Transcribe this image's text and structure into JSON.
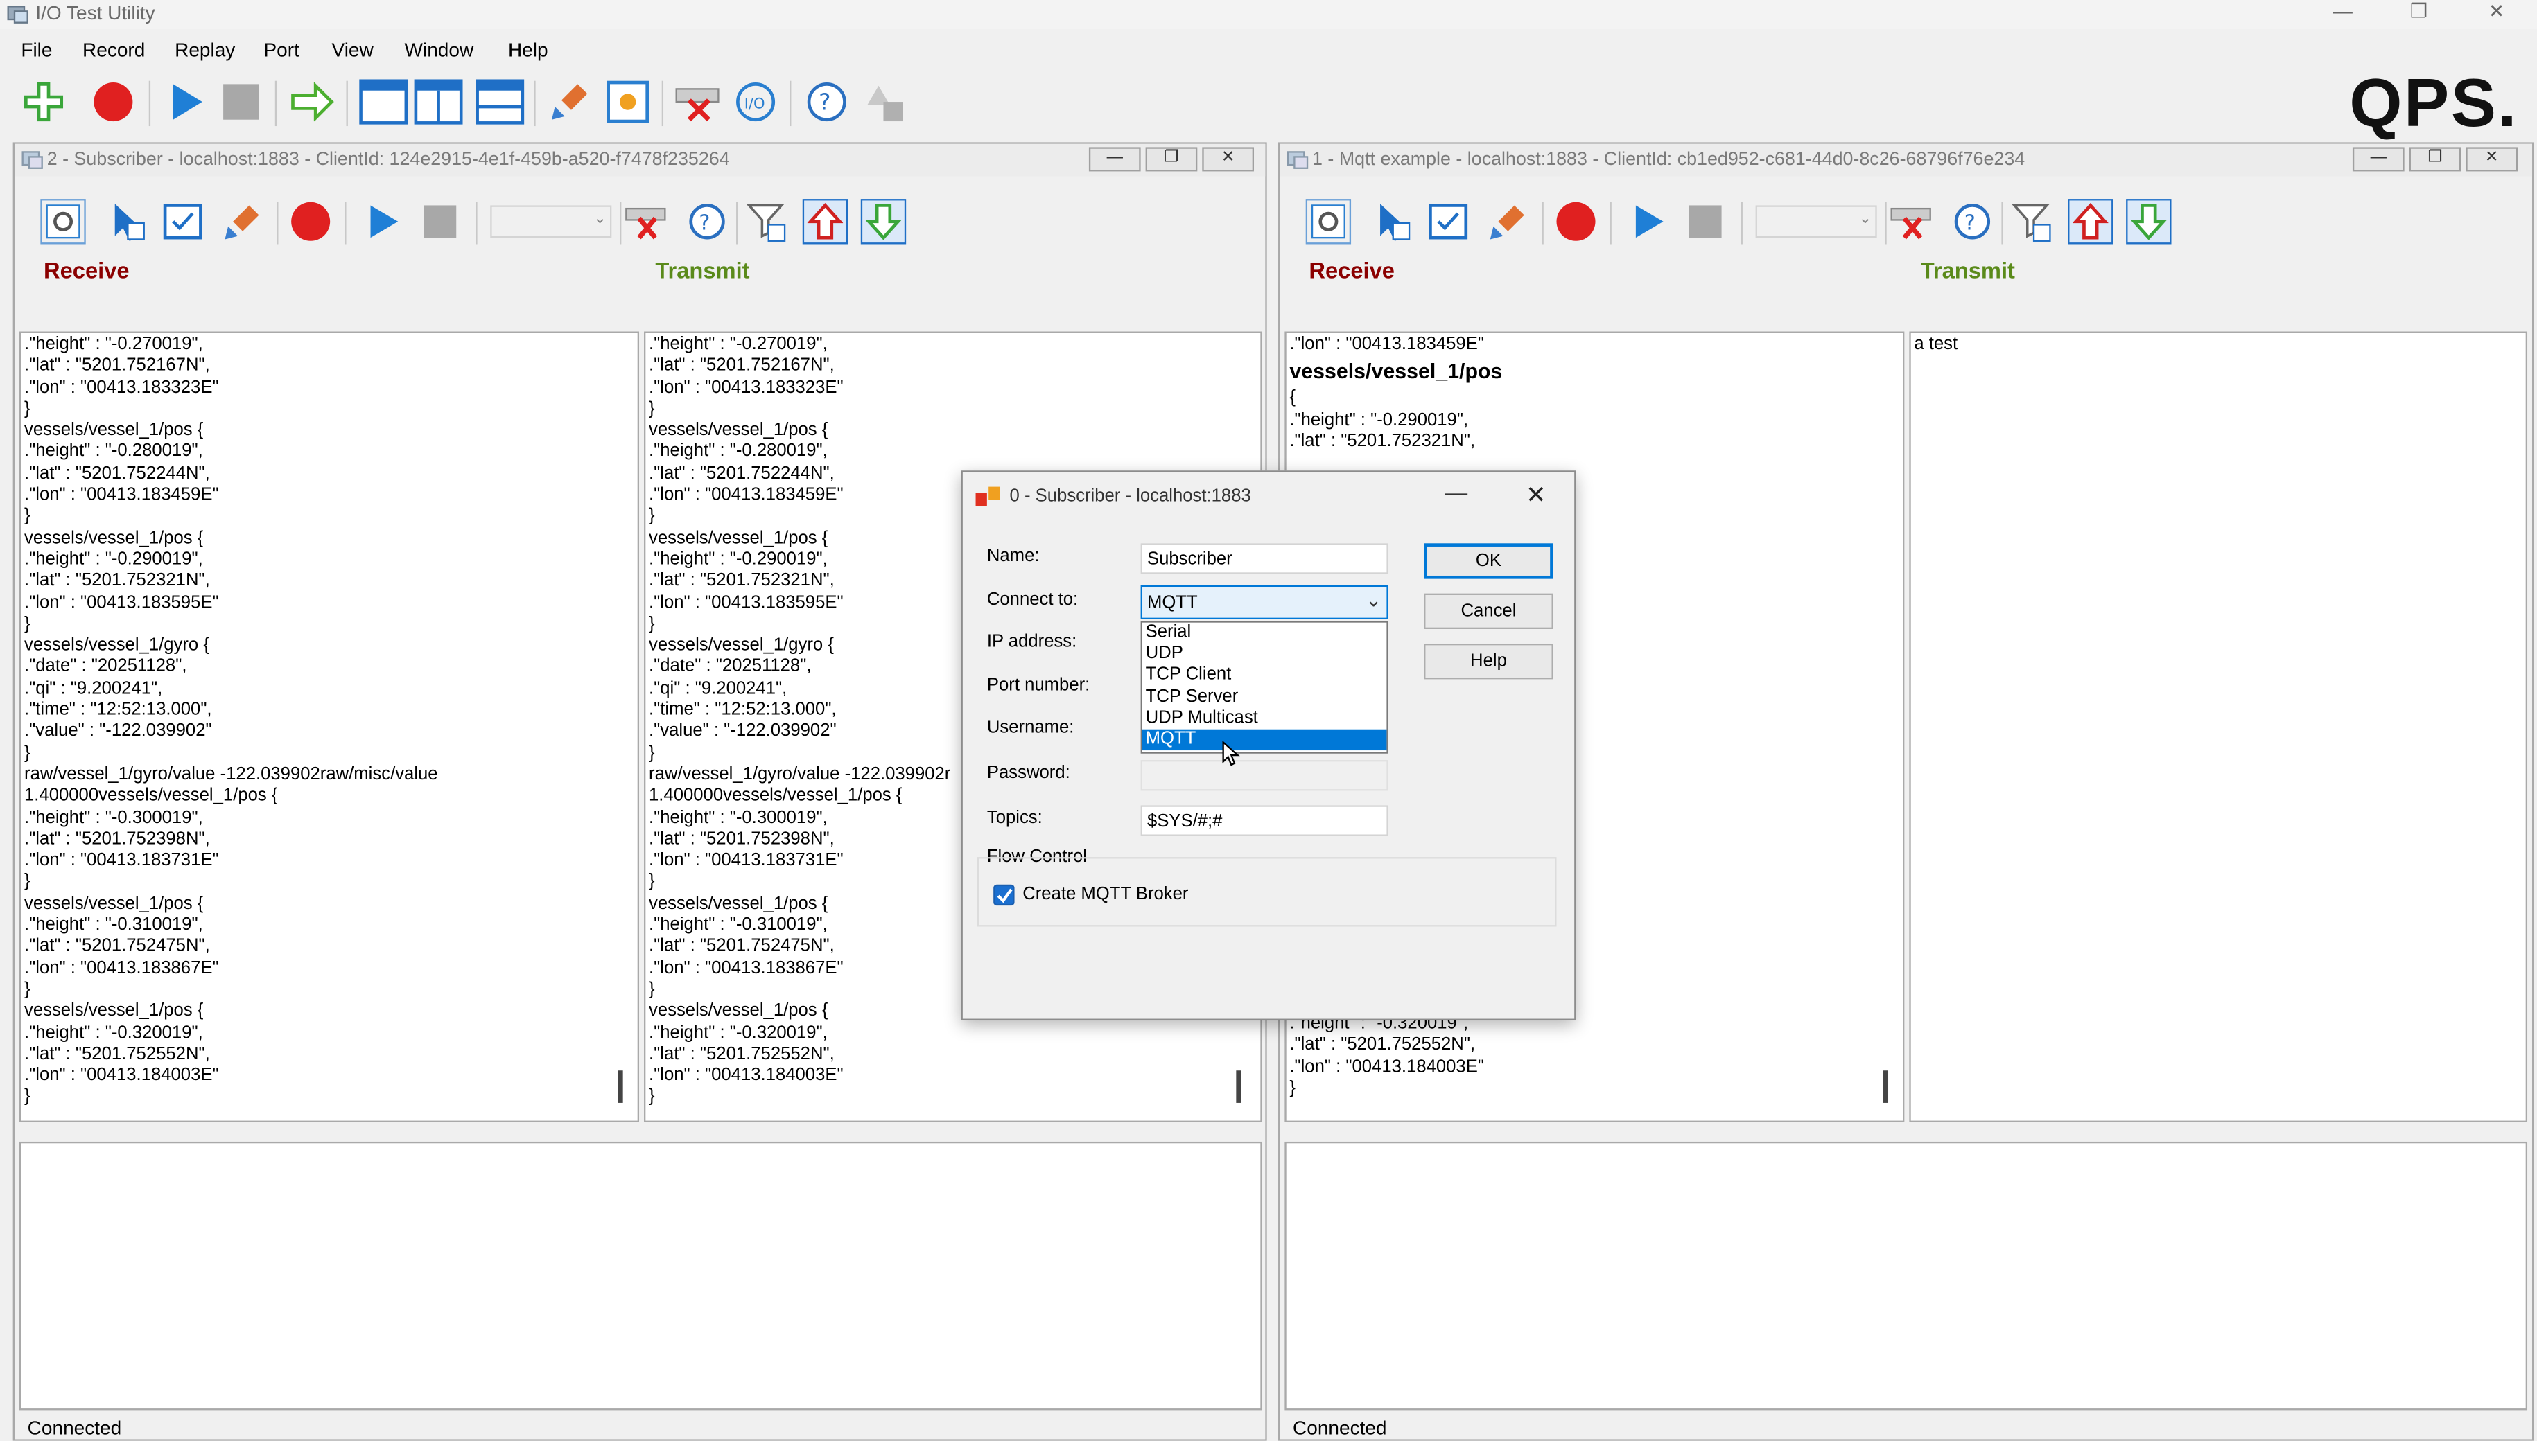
{
  "app": {
    "title": "I/O Test Utility",
    "logo": "QPS."
  },
  "menu": [
    "File",
    "Record",
    "Replay",
    "Port",
    "View",
    "Window",
    "Help"
  ],
  "labels": {
    "receive": "Receive",
    "transmit": "Transmit",
    "status": "Connected"
  },
  "colors": {
    "receive": "#8b0000",
    "transmit": "#5a8a1a",
    "selection": "#0078d7"
  },
  "win_left": {
    "title": "2 - Subscriber - localhost:1883 - ClientId: 124e2915-4e1f-459b-a520-f7478f235264",
    "receive_text": ".\"height\" : \"-0.270019\",\n.\"lat\" : \"5201.752167N\",\n.\"lon\" : \"00413.183323E\"\n}\nvessels/vessel_1/pos {\n.\"height\" : \"-0.280019\",\n.\"lat\" : \"5201.752244N\",\n.\"lon\" : \"00413.183459E\"\n}\nvessels/vessel_1/pos {\n.\"height\" : \"-0.290019\",\n.\"lat\" : \"5201.752321N\",\n.\"lon\" : \"00413.183595E\"\n}\nvessels/vessel_1/gyro {\n.\"date\" : \"20251128\",\n.\"qi\" : \"9.200241\",\n.\"time\" : \"12:52:13.000\",\n.\"value\" : \"-122.039902\"\n}\nraw/vessel_1/gyro/value -122.039902raw/misc/value\n1.400000vessels/vessel_1/pos {\n.\"height\" : \"-0.300019\",\n.\"lat\" : \"5201.752398N\",\n.\"lon\" : \"00413.183731E\"\n}\nvessels/vessel_1/pos {\n.\"height\" : \"-0.310019\",\n.\"lat\" : \"5201.752475N\",\n.\"lon\" : \"00413.183867E\"\n}\nvessels/vessel_1/pos {\n.\"height\" : \"-0.320019\",\n.\"lat\" : \"5201.752552N\",\n.\"lon\" : \"00413.184003E\"\n}",
    "transmit_text": ".\"height\" : \"-0.270019\",\n.\"lat\" : \"5201.752167N\",\n.\"lon\" : \"00413.183323E\"\n}\nvessels/vessel_1/pos {\n.\"height\" : \"-0.280019\",\n.\"lat\" : \"5201.752244N\",\n.\"lon\" : \"00413.183459E\"\n}\nvessels/vessel_1/pos {\n.\"height\" : \"-0.290019\",\n.\"lat\" : \"5201.752321N\",\n.\"lon\" : \"00413.183595E\"\n}\nvessels/vessel_1/gyro {\n.\"date\" : \"20251128\",\n.\"qi\" : \"9.200241\",\n.\"time\" : \"12:52:13.000\",\n.\"value\" : \"-122.039902\"\n}\nraw/vessel_1/gyro/value -122.039902r\n1.400000vessels/vessel_1/pos {\n.\"height\" : \"-0.300019\",\n.\"lat\" : \"5201.752398N\",\n.\"lon\" : \"00413.183731E\"\n}\nvessels/vessel_1/pos {\n.\"height\" : \"-0.310019\",\n.\"lat\" : \"5201.752475N\",\n.\"lon\" : \"00413.183867E\"\n}\nvessels/vessel_1/pos {\n.\"height\" : \"-0.320019\",\n.\"lat\" : \"5201.752552N\",\n.\"lon\" : \"00413.184003E\"\n}"
  },
  "win_right": {
    "title": "1 - Mqtt example - localhost:1883 - ClientId: cb1ed952-c681-44d0-8c26-68796f76e234",
    "receive_top": ".\"lon\" : \"00413.183459E\"",
    "receive_bold": "vessels/vessel_1/pos",
    "receive_mid": "{\n.\"height\" : \"-0.290019\",\n.\"lat\" : \"5201.752321N\",",
    "receive_bottom": ".\"height\" : \"-0.320019\",\n.\"lat\" : \"5201.752552N\",\n.\"lon\" : \"00413.184003E\"\n}",
    "transmit_text": "a test"
  },
  "dialog": {
    "title": "0 - Subscriber - localhost:1883",
    "name_label": "Name:",
    "name_value": "Subscriber",
    "connect_label": "Connect to:",
    "connect_value": "MQTT",
    "ip_label": "IP address:",
    "port_label": "Port number:",
    "user_label": "Username:",
    "pass_label": "Password:",
    "topics_label": "Topics:",
    "topics_value": "$SYS/#;#",
    "flow_label": "Flow Control",
    "broker_label": "Create MQTT Broker",
    "broker_checked": true,
    "ok": "OK",
    "cancel": "Cancel",
    "help": "Help",
    "options": [
      "Serial",
      "UDP",
      "TCP Client",
      "TCP Server",
      "UDP Multicast",
      "MQTT"
    ],
    "selected_index": 5
  }
}
